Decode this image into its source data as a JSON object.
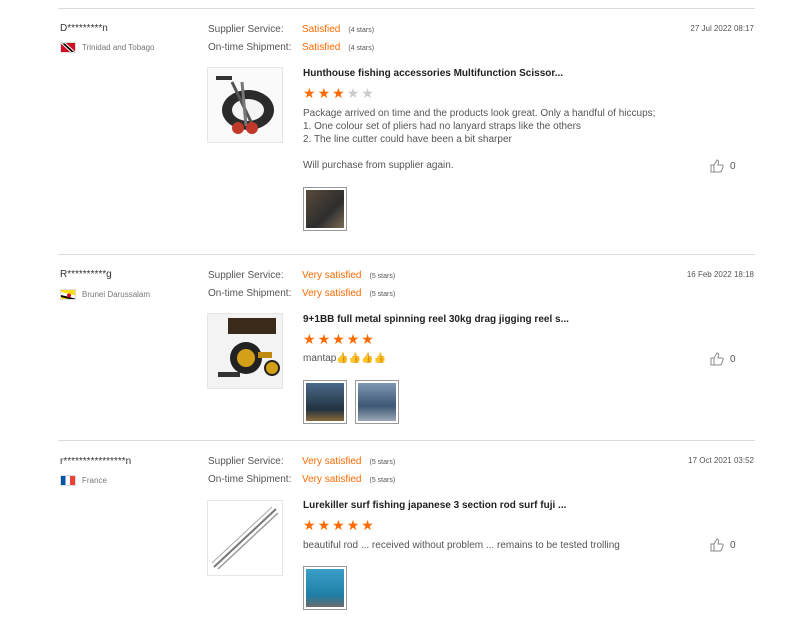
{
  "reviews": [
    {
      "user": "D*********n",
      "country": "Trinidad and Tobago",
      "supplier_label": "Supplier Service:",
      "supplier_value": "Satisfied",
      "supplier_stars": "(4 stars)",
      "shipment_label": "On-time Shipment:",
      "shipment_value": "Satisfied",
      "shipment_stars": "(4 stars)",
      "date": "27 Jul 2022 08:17",
      "product_title": "Hunthouse fishing accessories Multifunction Scissor...",
      "rating": 3,
      "text_lines": [
        "Package arrived on time and the products look great. Only a handful of hiccups;",
        "1. One colour set of pliers had no lanyard straps like the others",
        "2. The line cutter could have been a bit sharper",
        "",
        "Will purchase from supplier again."
      ],
      "likes": "0",
      "photos": 1
    },
    {
      "user": "R**********g",
      "country": "Brunei Darussalam",
      "supplier_label": "Supplier Service:",
      "supplier_value": "Very satisfied",
      "supplier_stars": "(5 stars)",
      "shipment_label": "On-time Shipment:",
      "shipment_value": "Very satisfied",
      "shipment_stars": "(5 stars)",
      "date": "16 Feb 2022 18:18",
      "product_title": "9+1BB full metal spinning reel 30kg drag jigging reel s...",
      "rating": 5,
      "text_lines": [
        "mantap👍👍👍👍"
      ],
      "likes": "0",
      "photos": 2
    },
    {
      "user": "r****************n",
      "country": "France",
      "supplier_label": "Supplier Service:",
      "supplier_value": "Very satisfied",
      "supplier_stars": "(5 stars)",
      "shipment_label": "On-time Shipment:",
      "shipment_value": "Very satisfied",
      "shipment_stars": "(5 stars)",
      "date": "17 Oct 2021 03:52",
      "product_title": "Lurekiller surf fishing japanese 3 section rod surf fuji ...",
      "rating": 5,
      "text_lines": [
        "beautiful rod ... received without problem ... remains to be tested trolling"
      ],
      "likes": "0",
      "photos": 1
    }
  ],
  "colors": {
    "accent": "#ff6a00"
  },
  "icons": [
    "thumbs-up-icon",
    "star-icon",
    "flag-icon"
  ]
}
